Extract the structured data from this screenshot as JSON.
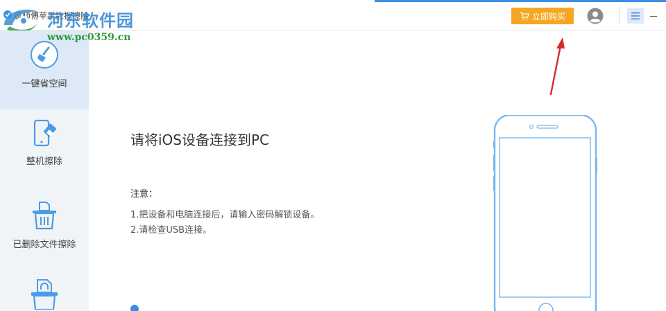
{
  "window": {
    "title": "疯师傅苹果数据擦除",
    "buy_label": "立即购买",
    "accent_color": "#3a8ee6",
    "buy_color": "#f5a623"
  },
  "watermark": {
    "title": "河东软件园",
    "url": "www.pc0359.cn"
  },
  "sidebar": {
    "items": [
      {
        "label": "一键省空间",
        "icon": "broom-icon",
        "active": true
      },
      {
        "label": "整机擦除",
        "icon": "phone-eraser-icon",
        "active": false
      },
      {
        "label": "已删除文件擦除",
        "icon": "trash-file-icon",
        "active": false
      },
      {
        "label": "",
        "icon": "lock-file-icon",
        "active": false
      }
    ]
  },
  "main": {
    "heading": "请将iOS设备连接到PC",
    "notice_title": "注意：",
    "notice_lines": [
      "1.把设备和电脑连接后，请输入密码解锁设备。",
      "2.请检查USB连接。"
    ],
    "bottom_link": ""
  }
}
